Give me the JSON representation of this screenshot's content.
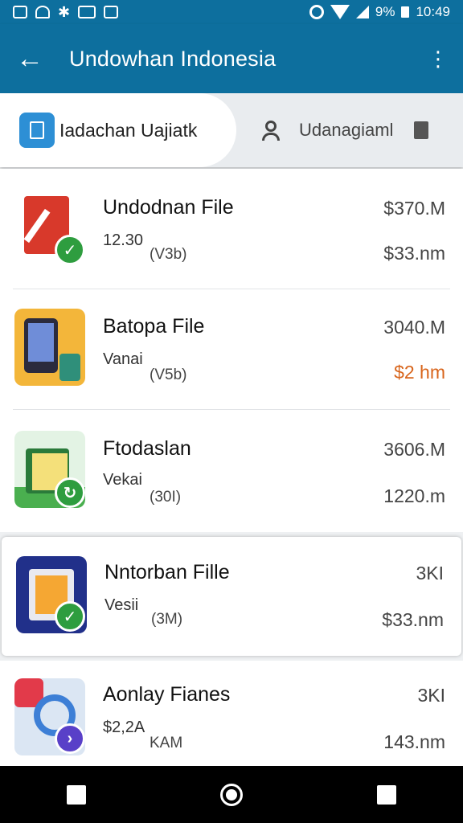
{
  "status_bar": {
    "battery": "9%",
    "time": "10:49"
  },
  "app_bar": {
    "title": "Undowhan Indonesia",
    "back_icon": "arrow-left-icon",
    "menu_icon": "more-vert-icon"
  },
  "tabs": [
    {
      "label": "Iadachan Uajiatk",
      "icon": "document-icon",
      "active": true
    },
    {
      "label": "Udanagiaml",
      "icon": "person-icon",
      "active": false
    }
  ],
  "files": [
    {
      "title": "Undodnan File",
      "sub": "12.30",
      "sub2": "(V3b)",
      "size": "$370.M",
      "size2": "$33.nm",
      "accent": "#d8651c"
    },
    {
      "title": "Batopa File",
      "sub": "Vanai",
      "sub2": "(V5b)",
      "size": "3040.M",
      "size2": "$2 hm",
      "accent": "#d8651c"
    },
    {
      "title": "Ftodaslan",
      "sub": "Vekai",
      "sub2": "(30I)",
      "size": "3606.M",
      "size2": "1220.m"
    },
    {
      "title": "Nntorban Fille",
      "sub": "Vesii",
      "sub2": "(3M)",
      "size": "3KI",
      "size2": "$33.nm"
    },
    {
      "title": "Aonlay Fianes",
      "sub": "$2,2A",
      "sub2": "KAM",
      "size": "3KI",
      "size2": "143.nm"
    }
  ],
  "colors": {
    "primary": "#0d6f9e",
    "check_green": "#2e9d3f",
    "badge_purple": "#5940c8",
    "orange": "#d8651c"
  }
}
